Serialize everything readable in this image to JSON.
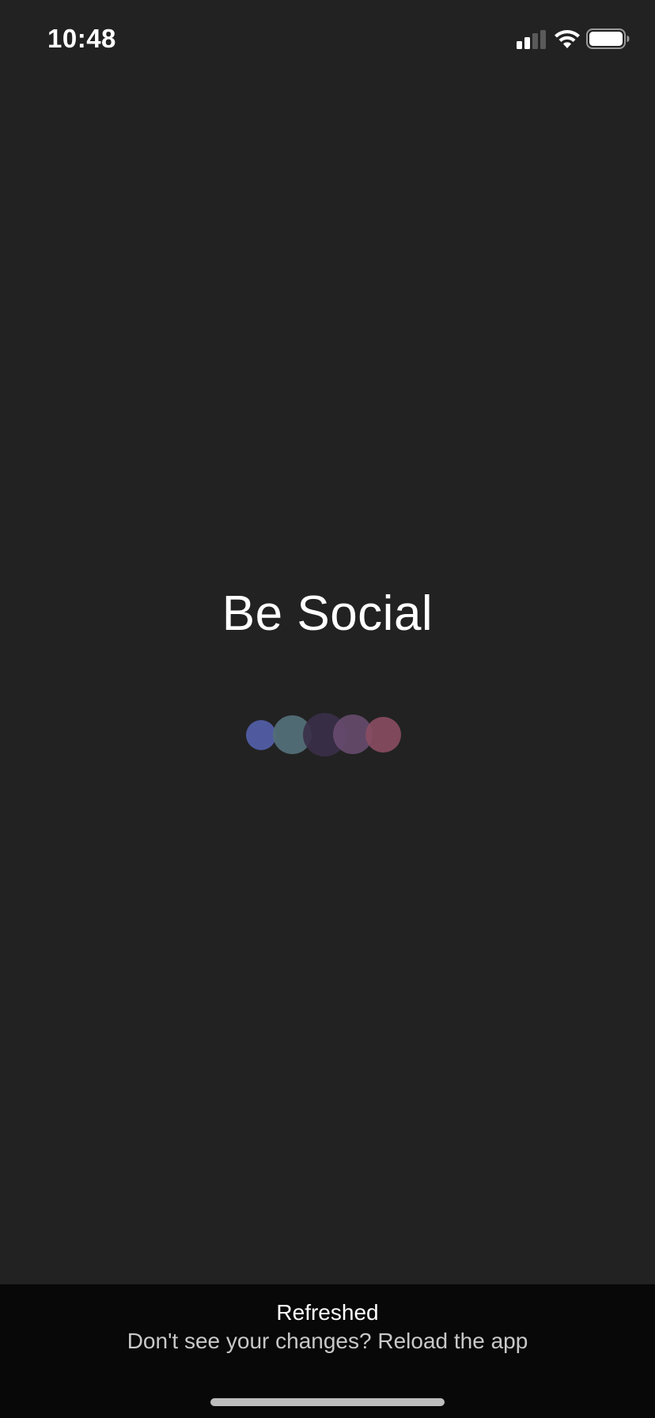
{
  "status_bar": {
    "time": "10:48",
    "icons": [
      "signal-icon",
      "wifi-icon",
      "battery-icon"
    ],
    "battery_level": 1.0
  },
  "splash": {
    "title": "Be Social",
    "loader_colors": [
      "#4f5a9e",
      "#536f78",
      "#3a2f48",
      "#6b4e72",
      "#8a4d62"
    ]
  },
  "toast": {
    "title": "Refreshed",
    "subtitle": "Don't see your changes? Reload the app"
  },
  "colors": {
    "background": "#222222",
    "toast_background": "#080808",
    "text": "#ffffff"
  }
}
